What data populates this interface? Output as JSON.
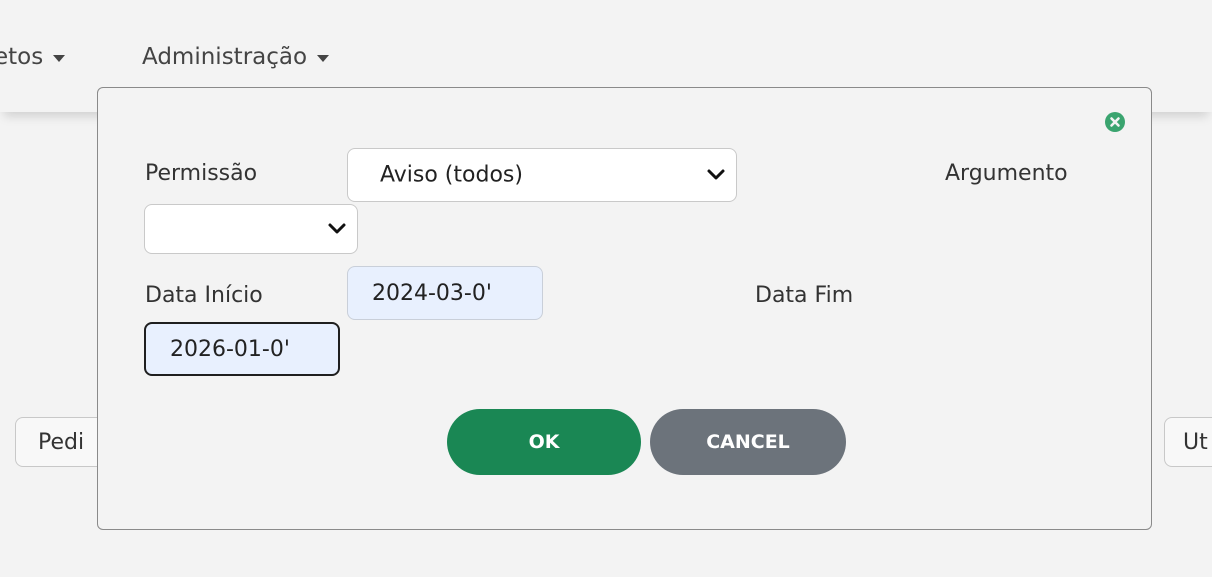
{
  "navbar": {
    "items": [
      {
        "label": "etos"
      },
      {
        "label": "Administração"
      }
    ]
  },
  "background": {
    "left_button_label": "Pedi",
    "right_button_label": "Ut"
  },
  "dialog": {
    "permission": {
      "label": "Permissão",
      "selected": "Aviso (todos)"
    },
    "argument": {
      "label": "Argumento",
      "selected": ""
    },
    "start_date": {
      "label": "Data Início",
      "value": "2024-03-0'"
    },
    "end_date": {
      "label": "Data Fim",
      "value": "2026-01-0'"
    },
    "ok_label": "OK",
    "cancel_label": "CANCEL"
  },
  "colors": {
    "ok": "#1a8754",
    "cancel": "#6c737b",
    "close_icon": "#3aa46f",
    "date_field_bg": "#e8f0fe"
  },
  "icons": {
    "close": "close-circle-icon",
    "select_arrow": "chevron-down-icon",
    "nav_caret": "caret-down-icon"
  }
}
